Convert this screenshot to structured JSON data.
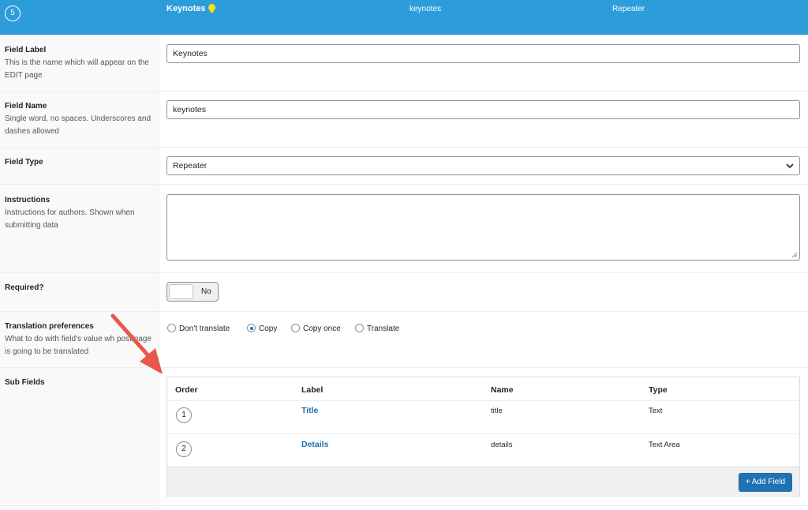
{
  "header": {
    "order": "5",
    "label": "Keynotes",
    "name": "keynotes",
    "type": "Repeater"
  },
  "fields": {
    "label": {
      "title": "Field Label",
      "desc": "This is the name which will appear on the EDIT page",
      "value": "Keynotes"
    },
    "name": {
      "title": "Field Name",
      "desc": "Single word, no spaces. Underscores and dashes allowed",
      "value": "keynotes"
    },
    "type": {
      "title": "Field Type",
      "value": "Repeater"
    },
    "instructions": {
      "title": "Instructions",
      "desc": "Instructions for authors. Shown when submitting data",
      "value": ""
    },
    "required": {
      "title": "Required?",
      "toggle_label": "No"
    },
    "translation": {
      "title": "Translation preferences",
      "desc": "What to do with field's value wh post/page is going to be translated",
      "options": [
        "Don't translate",
        "Copy",
        "Copy once",
        "Translate"
      ],
      "selected": "Copy"
    },
    "sub_fields": {
      "title": "Sub Fields",
      "columns": [
        "Order",
        "Label",
        "Name",
        "Type"
      ],
      "rows": [
        {
          "order": "1",
          "label": "Title",
          "name": "title",
          "type": "Text"
        },
        {
          "order": "2",
          "label": "Details",
          "name": "details",
          "type": "Text Area"
        }
      ],
      "add_button": "+ Add Field"
    }
  },
  "colors": {
    "header": "#2d9cdb",
    "accent": "#2271b1",
    "arrow": "#e8574a"
  },
  "icons": [
    "lightbulb-icon",
    "chevron-down-icon",
    "resize-handle-icon",
    "arrow-annotation-icon"
  ]
}
